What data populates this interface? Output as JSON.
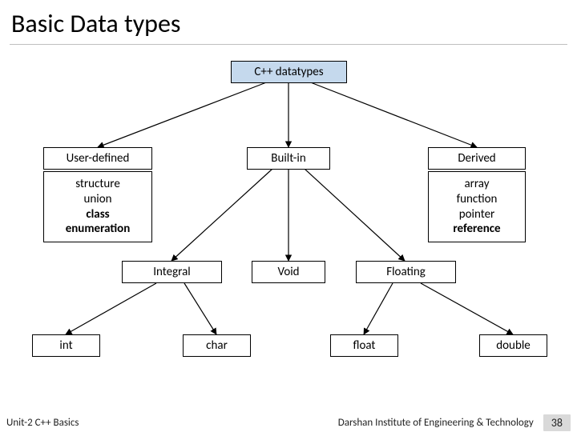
{
  "title": "Basic Data types",
  "root": {
    "label": "C++ datatypes"
  },
  "level1": {
    "user_defined": {
      "header": "User-defined",
      "items": [
        "structure",
        "union",
        "class",
        "enumeration"
      ],
      "bold_indices": [
        2,
        3
      ]
    },
    "built_in": {
      "header": "Built-in"
    },
    "derived": {
      "header": "Derived",
      "items": [
        "array",
        "function",
        "pointer",
        "reference"
      ],
      "bold_indices": [
        3
      ]
    }
  },
  "level2": {
    "integral": "Integral",
    "void": "Void",
    "floating": "Floating"
  },
  "leaves": {
    "int": "int",
    "char": "char",
    "float": "float",
    "double": "double"
  },
  "footer": {
    "left": "Unit-2 C++ Basics",
    "right": "Darshan Institute of Engineering & Technology",
    "page": "38"
  },
  "chart_data": {
    "type": "tree",
    "title": "C++ datatypes hierarchy",
    "root": "C++ datatypes",
    "children": [
      {
        "name": "User-defined",
        "members": [
          "structure",
          "union",
          "class",
          "enumeration"
        ]
      },
      {
        "name": "Built-in",
        "children": [
          {
            "name": "Integral",
            "children": [
              "int",
              "char"
            ]
          },
          {
            "name": "Void"
          },
          {
            "name": "Floating",
            "children": [
              "float",
              "double"
            ]
          }
        ]
      },
      {
        "name": "Derived",
        "members": [
          "array",
          "function",
          "pointer",
          "reference"
        ]
      }
    ]
  }
}
